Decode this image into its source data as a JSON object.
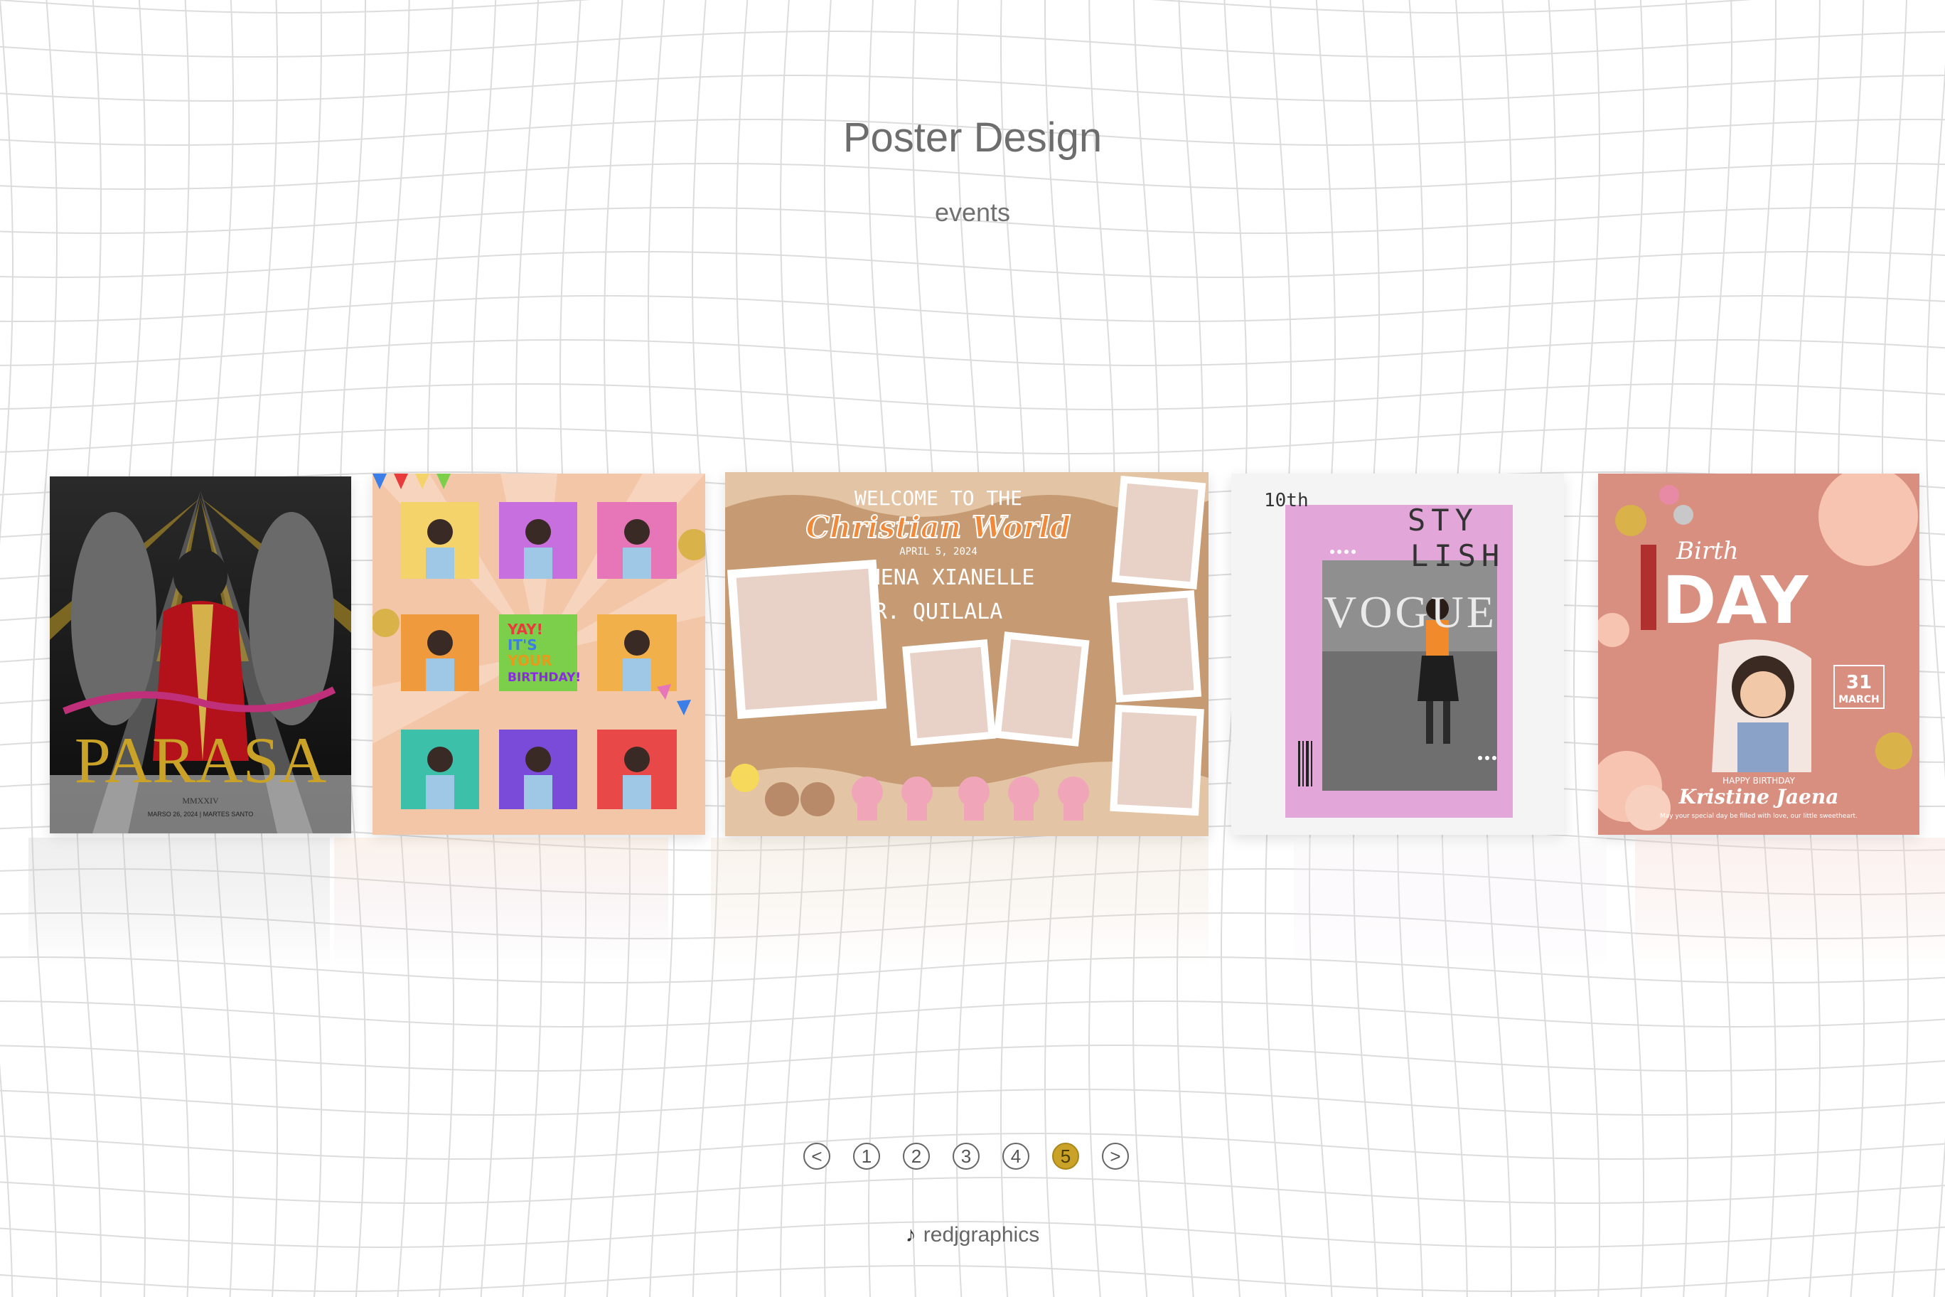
{
  "header": {
    "title": "Poster Design",
    "subtitle": "events"
  },
  "posters": [
    {
      "name": "parasa-poster",
      "texts": {
        "main": "PARASA",
        "roman": "MMXXIV",
        "date": "MARSO 26, 2024 | MARTES SANTO"
      },
      "colors": {
        "bg": "#1a1a1a",
        "gold": "#c9a227",
        "red": "#b3121b"
      }
    },
    {
      "name": "birthday-collage-poster",
      "texts": {
        "yay": "YAY!",
        "its": "IT'S",
        "your": "YOUR",
        "birthday": "BIRTHDAY!"
      },
      "colors": {
        "bg": "#f3c6a8"
      }
    },
    {
      "name": "christian-world-poster",
      "texts": {
        "welcome": "WELCOME TO THE",
        "script": "Christian World",
        "date": "APRIL 5, 2024",
        "name1": "ATHENA XIANELLE",
        "name2": "R. QUILALA"
      },
      "colors": {
        "bg": "#c69a73",
        "script": "#f08a3a"
      }
    },
    {
      "name": "stylish-vogue-poster",
      "texts": {
        "tenth": "10th",
        "sty": "STY",
        "lish": "LISH",
        "vogue": "VOGUE"
      },
      "colors": {
        "bg": "#f4f4f4",
        "pink": "#e3a6d9"
      }
    },
    {
      "name": "kristine-birthday-poster",
      "texts": {
        "birth": "Birth",
        "day": "DAY",
        "happy": "HAPPY BIRTHDAY",
        "name": "Kristine Jaena",
        "date": "31",
        "month": "MARCH",
        "message": "May your special day be filled with love, our little sweetheart."
      },
      "colors": {
        "bg": "#d98f80"
      }
    }
  ],
  "pager": {
    "prev": "<",
    "pages": [
      "1",
      "2",
      "3",
      "4",
      "5"
    ],
    "active_page": 5,
    "next": ">"
  },
  "credit": {
    "icon": "tiktok-icon",
    "handle": "redjgraphics"
  }
}
